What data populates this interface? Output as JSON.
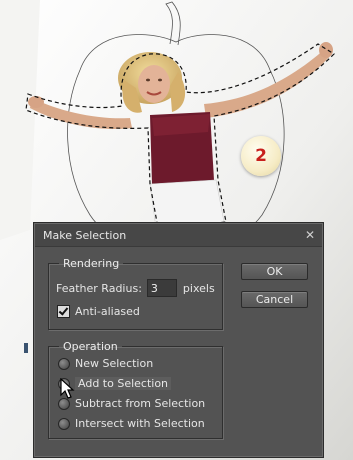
{
  "step_badge": "2",
  "dialog": {
    "title": "Make Selection",
    "close_icon": "close-icon",
    "rendering": {
      "legend": "Rendering",
      "feather_label": "Feather Radius:",
      "feather_value": "3",
      "feather_unit": "pixels",
      "anti_aliased_label": "Anti-aliased",
      "anti_aliased_checked": true
    },
    "operation": {
      "legend": "Operation",
      "options": [
        {
          "label": "New Selection",
          "selected": false
        },
        {
          "label": "Add to Selection",
          "selected": true
        },
        {
          "label": "Subtract from Selection",
          "selected": false
        },
        {
          "label": "Intersect with Selection",
          "selected": false
        }
      ]
    },
    "buttons": {
      "ok": "OK",
      "cancel": "Cancel"
    }
  },
  "colors": {
    "dialog_bg": "#535353",
    "badge_text": "#c8201c",
    "top_color": "#6d1a2c"
  }
}
